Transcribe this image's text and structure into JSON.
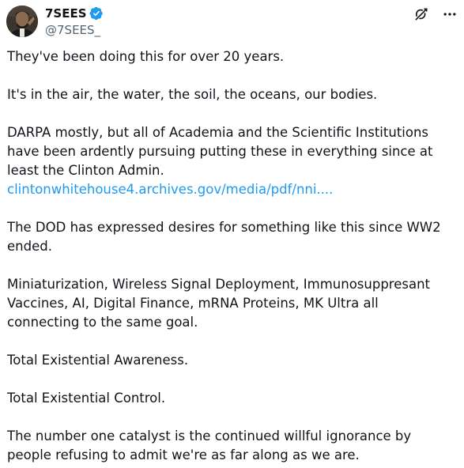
{
  "author": {
    "display_name": "7SEES",
    "handle": "@7SEES_",
    "verified_color": "#1d9bf0"
  },
  "icons": {
    "verified": "verified-badge-icon",
    "grok": "grok-icon",
    "more": "more-icon"
  },
  "tweet": {
    "p1": "They've been doing this for over 20 years.",
    "p2": "It's in the air, the water, the soil, the oceans, our bodies.",
    "p3": "DARPA mostly, but all of Academia and the Scientific Institutions have been ardently pursuing putting these in everything since at least the Clinton Admin.",
    "p3_link": "clintonwhitehouse4.archives.gov/media/pdf/nni....",
    "p4": "The DOD has expressed desires for something like this since WW2 ended.",
    "p5": "Miniaturization, Wireless Signal Deployment, Immunosuppresant Vaccines, AI, Digital Finance, mRNA Proteins, MK Ultra all connecting to the same goal.",
    "p6": "Total Existential Awareness.",
    "p7": "Total Existential Control.",
    "p8": "The number one catalyst is the continued willful ignorance by people refusing to admit we're as far along as we are."
  }
}
